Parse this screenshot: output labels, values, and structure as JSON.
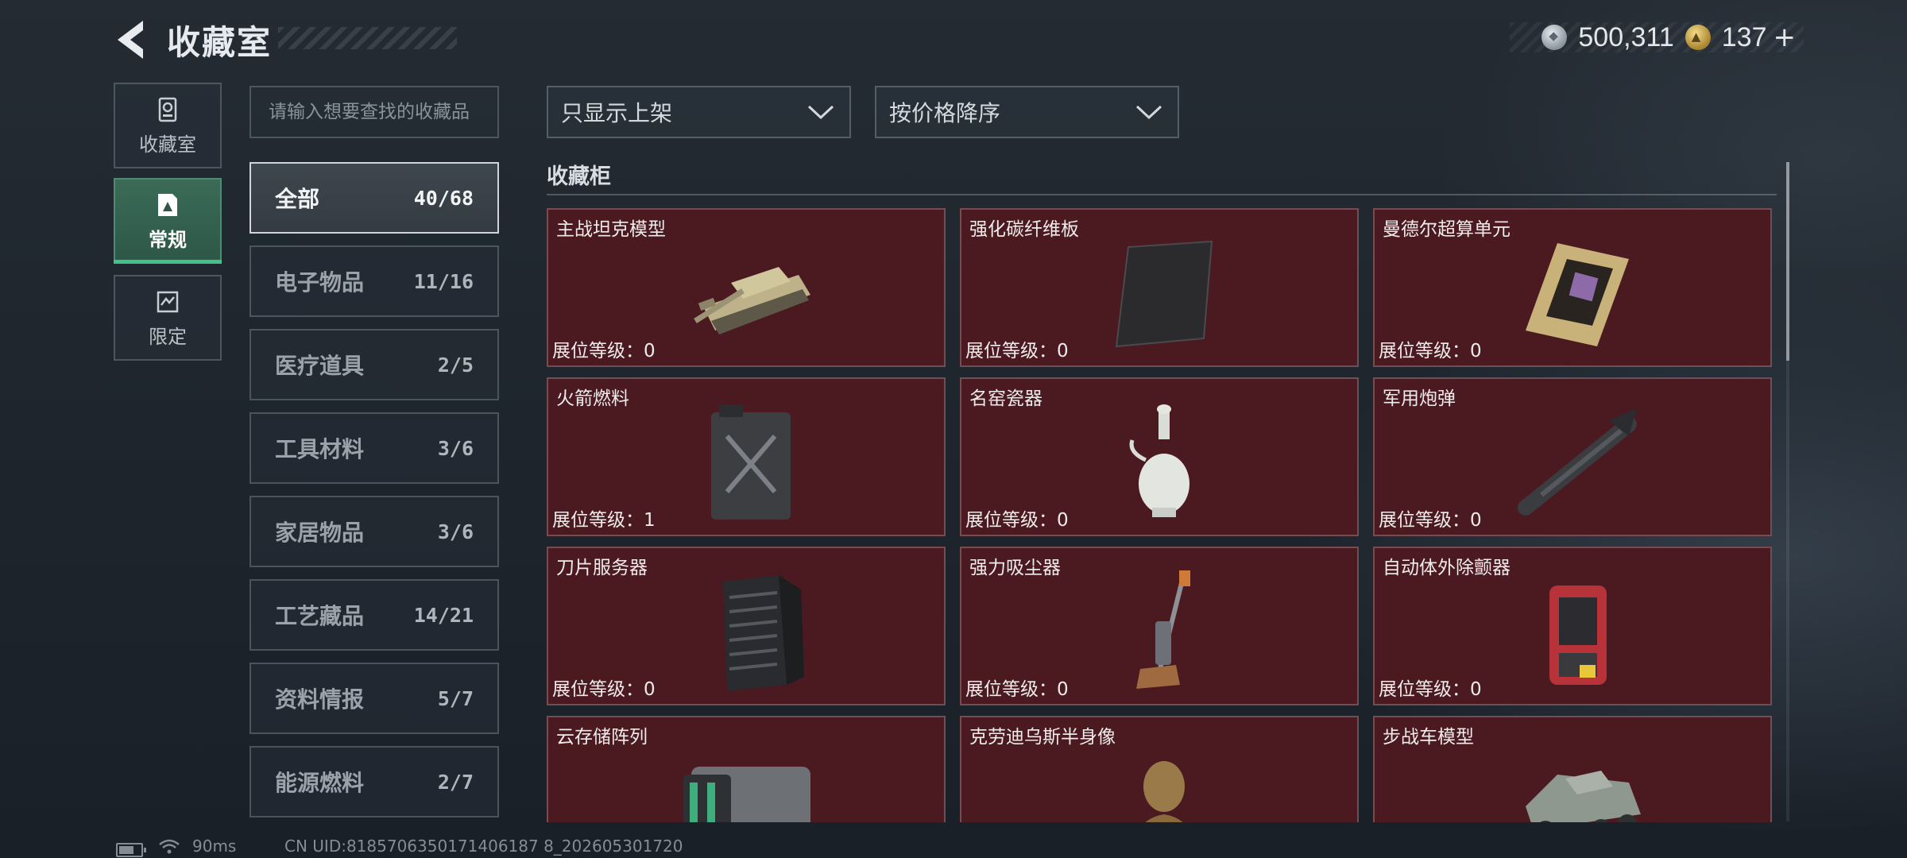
{
  "header": {
    "title": "收藏室",
    "currency": [
      {
        "icon": "silver-coin-icon",
        "value": "500,311"
      },
      {
        "icon": "gold-coin-icon",
        "value": "137",
        "plus": "+"
      }
    ]
  },
  "rail": [
    {
      "label": "收藏室",
      "icon": "collection-room-icon",
      "active": false
    },
    {
      "label": "常规",
      "icon": "regular-icon",
      "active": true
    },
    {
      "label": "限定",
      "icon": "limited-icon",
      "active": false
    }
  ],
  "search": {
    "placeholder": "请输入想要查找的收藏品"
  },
  "categories": [
    {
      "name": "全部",
      "count": "40/68",
      "active": true
    },
    {
      "name": "电子物品",
      "count": "11/16"
    },
    {
      "name": "医疗道具",
      "count": "2/5"
    },
    {
      "name": "工具材料",
      "count": "3/6"
    },
    {
      "name": "家居物品",
      "count": "3/6"
    },
    {
      "name": "工艺藏品",
      "count": "14/21"
    },
    {
      "name": "资料情报",
      "count": "5/7"
    },
    {
      "name": "能源燃料",
      "count": "2/7"
    }
  ],
  "filters": {
    "shelf": "只显示上架",
    "sort": "按价格降序"
  },
  "section": {
    "title": "收藏柜"
  },
  "cards": [
    {
      "name": "主战坦克模型",
      "level_label": "展位等级：",
      "level": "0",
      "icon": "tank-icon"
    },
    {
      "name": "强化碳纤维板",
      "level_label": "展位等级：",
      "level": "0",
      "icon": "carbon-plate-icon"
    },
    {
      "name": "曼德尔超算单元",
      "level_label": "展位等级：",
      "level": "0",
      "icon": "gpu-card-icon"
    },
    {
      "name": "火箭燃料",
      "level_label": "展位等级：",
      "level": "1",
      "icon": "fuel-can-icon"
    },
    {
      "name": "名窑瓷器",
      "level_label": "展位等级：",
      "level": "0",
      "icon": "porcelain-vase-icon"
    },
    {
      "name": "军用炮弹",
      "level_label": "展位等级：",
      "level": "0",
      "icon": "missile-icon"
    },
    {
      "name": "刀片服务器",
      "level_label": "展位等级：",
      "level": "0",
      "icon": "blade-server-icon"
    },
    {
      "name": "强力吸尘器",
      "level_label": "展位等级：",
      "level": "0",
      "icon": "vacuum-icon"
    },
    {
      "name": "自动体外除颤器",
      "level_label": "展位等级：",
      "level": "0",
      "icon": "defibrillator-icon"
    },
    {
      "name": "云存储阵列",
      "level_label": "",
      "level": "",
      "icon": "storage-array-icon"
    },
    {
      "name": "克劳迪乌斯半身像",
      "level_label": "",
      "level": "",
      "icon": "bust-icon"
    },
    {
      "name": "步战车模型",
      "level_label": "",
      "level": "",
      "icon": "ifv-icon"
    }
  ],
  "statusbar": {
    "ping": "90ms",
    "uid": "CN UID:8185706350171406187 8_202605301720"
  }
}
